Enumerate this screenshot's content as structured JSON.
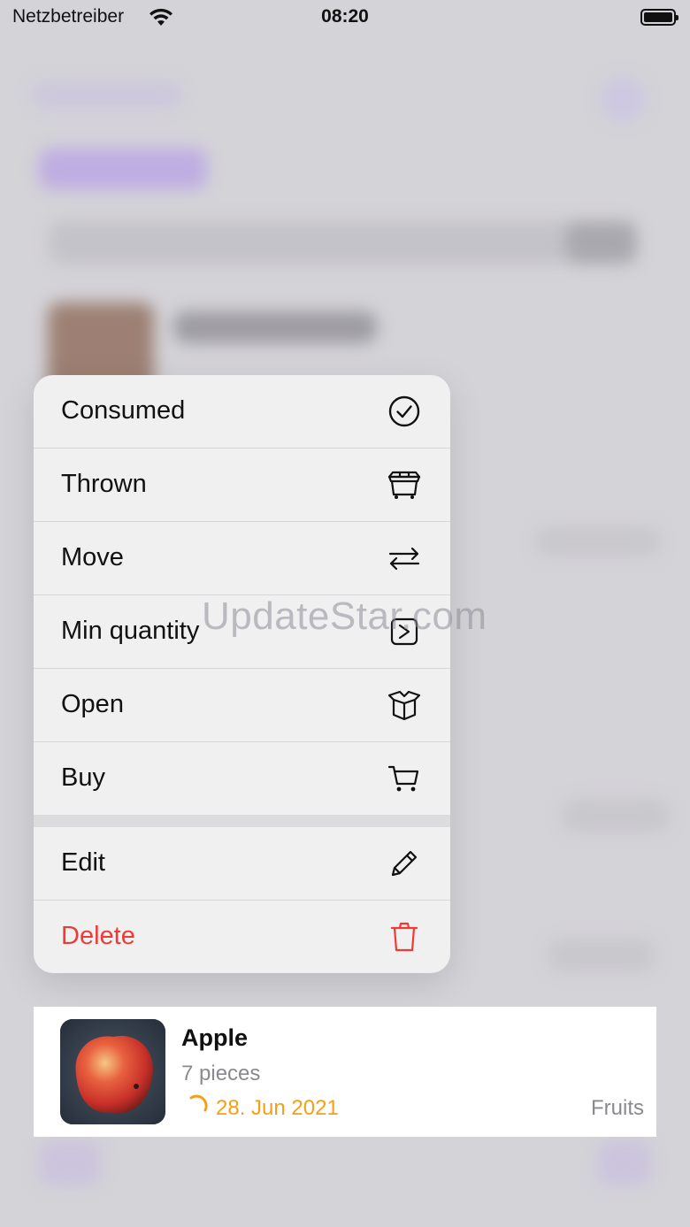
{
  "status_bar": {
    "carrier": "Netzbetreiber",
    "time": "08:20",
    "wifi_icon": "wifi-icon",
    "battery_icon": "battery-icon"
  },
  "context_menu": {
    "items": [
      {
        "label": "Consumed",
        "icon": "checkmark-circle-icon"
      },
      {
        "label": "Thrown",
        "icon": "dumpster-icon"
      },
      {
        "label": "Move",
        "icon": "arrows-left-right-icon"
      },
      {
        "label": "Min quantity",
        "icon": "chevron-right-square-icon"
      },
      {
        "label": "Open",
        "icon": "open-box-icon"
      },
      {
        "label": "Buy",
        "icon": "cart-icon"
      }
    ],
    "secondary_items": [
      {
        "label": "Edit",
        "icon": "pencil-icon"
      },
      {
        "label": "Delete",
        "icon": "trash-icon"
      }
    ],
    "colors": {
      "danger": "#ef3b36"
    }
  },
  "watermark": "UpdateStar.com",
  "preview_item": {
    "name": "Apple",
    "quantity": "7 pieces",
    "expiry_date": "28. Jun 2021",
    "category": "Fruits",
    "colors": {
      "expiry": "#f4a017"
    }
  }
}
